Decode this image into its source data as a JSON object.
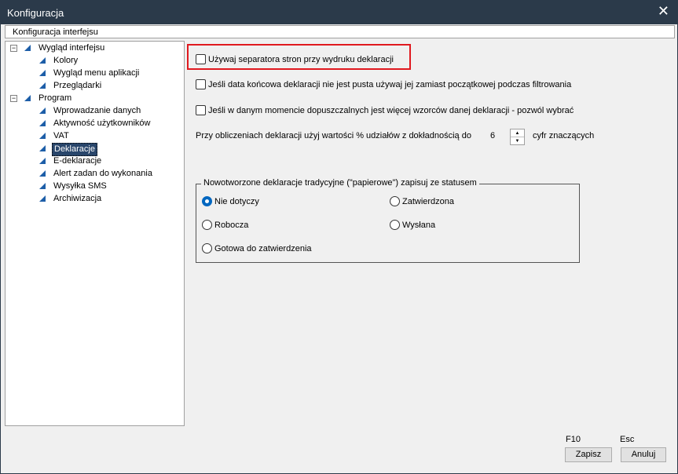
{
  "window": {
    "title": "Konfiguracja",
    "close_glyph": "✕"
  },
  "header": {
    "label": "Konfiguracja interfejsu"
  },
  "tree": {
    "groups": [
      {
        "label": "Wygląd interfejsu",
        "expander": "−",
        "children": [
          "Kolory",
          "Wygląd menu aplikacji",
          "Przeglądarki"
        ]
      },
      {
        "label": "Program",
        "expander": "−",
        "children": [
          "Wprowadzanie danych",
          "Aktywność użytkowników",
          "VAT",
          "Deklaracje",
          "E-deklaracje",
          "Alert zadan do wykonania",
          "Wysyłka SMS",
          "Archiwizacja"
        ]
      }
    ],
    "selected": "Deklaracje"
  },
  "options": {
    "separator": {
      "label": "Używaj separatora stron przy wydruku deklaracji",
      "checked": false
    },
    "end_date": {
      "label": "Jeśli data końcowa deklaracji nie jest pusta używaj jej zamiast początkowej podczas filtrowania",
      "checked": false
    },
    "multiple_templates": {
      "label": "Jeśli w danym momencie dopuszczalnych jest więcej wzorców danej deklaracji - pozwól wybrać",
      "checked": false
    }
  },
  "precision": {
    "label": "Przy obliczeniach deklaracji użyj wartości % udziałów z dokładnością do",
    "value": "6",
    "suffix": "cyfr znaczących",
    "up_glyph": "▲",
    "down_glyph": "▼"
  },
  "status_group": {
    "legend": "Nowotworzone deklaracje tradycyjne (\"papierowe\") zapisuj ze statusem",
    "selected": "Nie dotyczy",
    "options": [
      "Nie dotyczy",
      "Zatwierdzona",
      "Robocza",
      "Wysłana",
      "Gotowa do zatwierdzenia"
    ]
  },
  "footer": {
    "save_key": "F10",
    "cancel_key": "Esc",
    "save_label": "Zapisz",
    "cancel_label": "Anuluj"
  },
  "colors": {
    "titlebar": "#2b3a4a",
    "highlight": "#e0191f",
    "tree_icon": "#1d5ea8",
    "selection": "#29466b",
    "radio_accent": "#0067c0"
  }
}
